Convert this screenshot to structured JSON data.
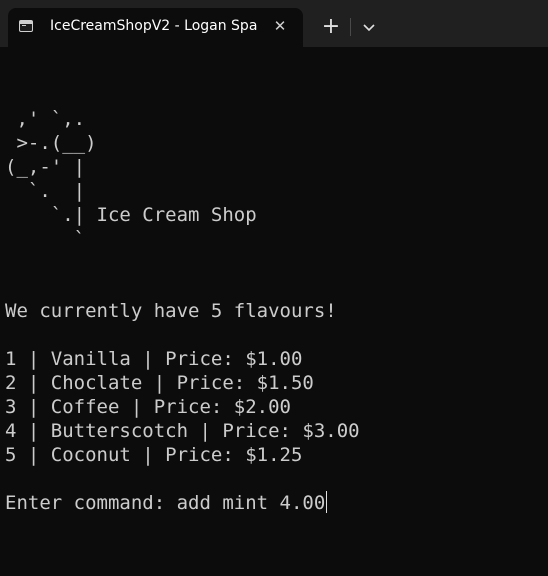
{
  "tab": {
    "title": "IceCreamShopV2 - Logan Spa",
    "icon": "terminal-icon",
    "close_icon": "close-icon"
  },
  "titlebar": {
    "new_tab_icon": "plus-icon",
    "dropdown_icon": "chevron-down-icon"
  },
  "terminal": {
    "ascii_art": [
      " ,' `,.",
      " >-.(__)",
      "(_,-' |",
      "  `.  |",
      "    `.| Ice Cream Shop",
      "      `"
    ],
    "flavour_count_line": "We currently have 5 flavours!",
    "flavours": [
      "1 | Vanilla | Price: $1.00",
      "2 | Choclate | Price: $1.50",
      "3 | Coffee | Price: $2.00",
      "4 | Butterscotch | Price: $3.00",
      "5 | Coconut | Price: $1.25"
    ],
    "command_prompt": "Enter command: ",
    "command_input": "add mint 4.00"
  }
}
